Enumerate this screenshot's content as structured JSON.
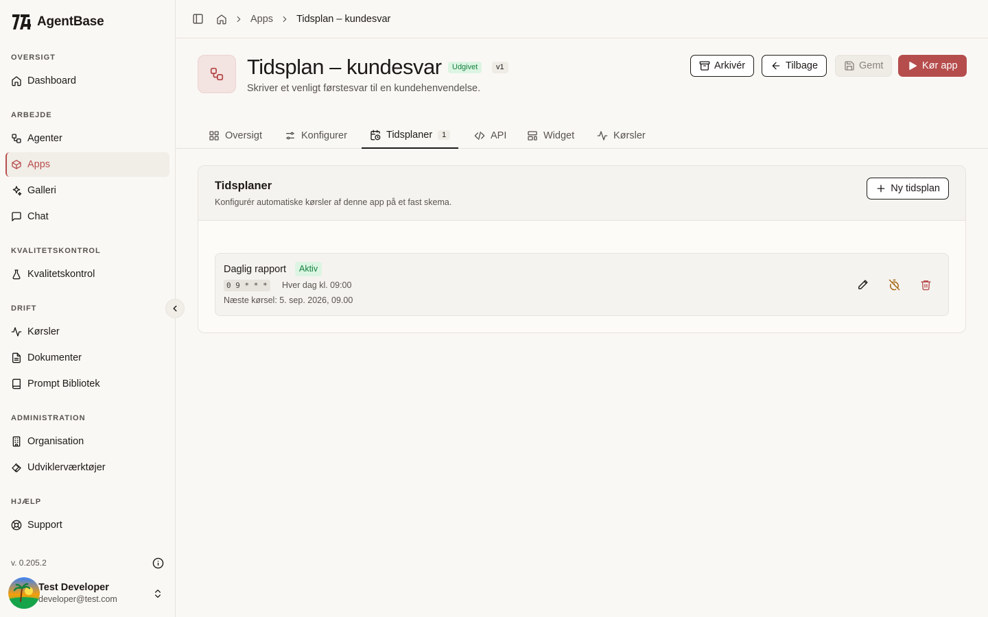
{
  "brand": {
    "name": "AgentBase"
  },
  "sidebar": {
    "sections": [
      {
        "label": "OVERSIGT"
      },
      {
        "label": "ARBEJDE"
      },
      {
        "label": "KVALITETSKONTROL"
      },
      {
        "label": "DRIFT"
      },
      {
        "label": "ADMINISTRATION"
      },
      {
        "label": "HJÆLP"
      }
    ],
    "items": [
      {
        "label": "Dashboard",
        "icon": "home-icon"
      },
      {
        "label": "Agenter",
        "icon": "workflow-icon"
      },
      {
        "label": "Apps",
        "icon": "box-icon",
        "active": true
      },
      {
        "label": "Galleri",
        "icon": "sparkles-icon"
      },
      {
        "label": "Chat",
        "icon": "message-icon"
      },
      {
        "label": "Kvalitetskontrol",
        "icon": "flask-icon"
      },
      {
        "label": "Kørsler",
        "icon": "activity-icon"
      },
      {
        "label": "Dokumenter",
        "icon": "file-text-icon"
      },
      {
        "label": "Prompt Bibliotek",
        "icon": "book-icon"
      },
      {
        "label": "Organisation",
        "icon": "building-icon"
      },
      {
        "label": "Udviklerværktøjer",
        "icon": "wrench-icon"
      },
      {
        "label": "Support",
        "icon": "lifebuoy-icon"
      }
    ],
    "version": "v. 0.205.2",
    "user": {
      "name": "Test Developer",
      "email": "developer@test.com"
    }
  },
  "breadcrumb": {
    "items": [
      "Apps",
      "Tidsplan – kundesvar"
    ]
  },
  "app": {
    "title": "Tidsplan – kundesvar",
    "status_badge": "Udgivet",
    "version_badge": "v1",
    "description": "Skriver et venligt førstesvar til en kundehenvendelse."
  },
  "actions": {
    "archive": "Arkivér",
    "back": "Tilbage",
    "saved": "Gemt",
    "run": "Kør app"
  },
  "tabs": [
    {
      "label": "Oversigt"
    },
    {
      "label": "Konfigurer"
    },
    {
      "label": "Tidsplaner",
      "count": "1",
      "active": true
    },
    {
      "label": "API"
    },
    {
      "label": "Widget"
    },
    {
      "label": "Kørsler"
    }
  ],
  "schedules_card": {
    "title": "Tidsplaner",
    "description": "Konfigurér automatiske kørsler af denne app på et fast skema.",
    "new_button": "Ny tidsplan",
    "items": [
      {
        "name": "Daglig rapport",
        "status": "Aktiv",
        "cron": "0 9 * * *",
        "human": "Hver dag kl. 09:00",
        "next_run": "Næste kørsel: 5. sep. 2026, 09.00"
      }
    ]
  },
  "colors": {
    "accent": "#b64d4d",
    "success_bg": "#dcf5e3",
    "success_text": "#15803d",
    "background": "#faf8f5"
  }
}
